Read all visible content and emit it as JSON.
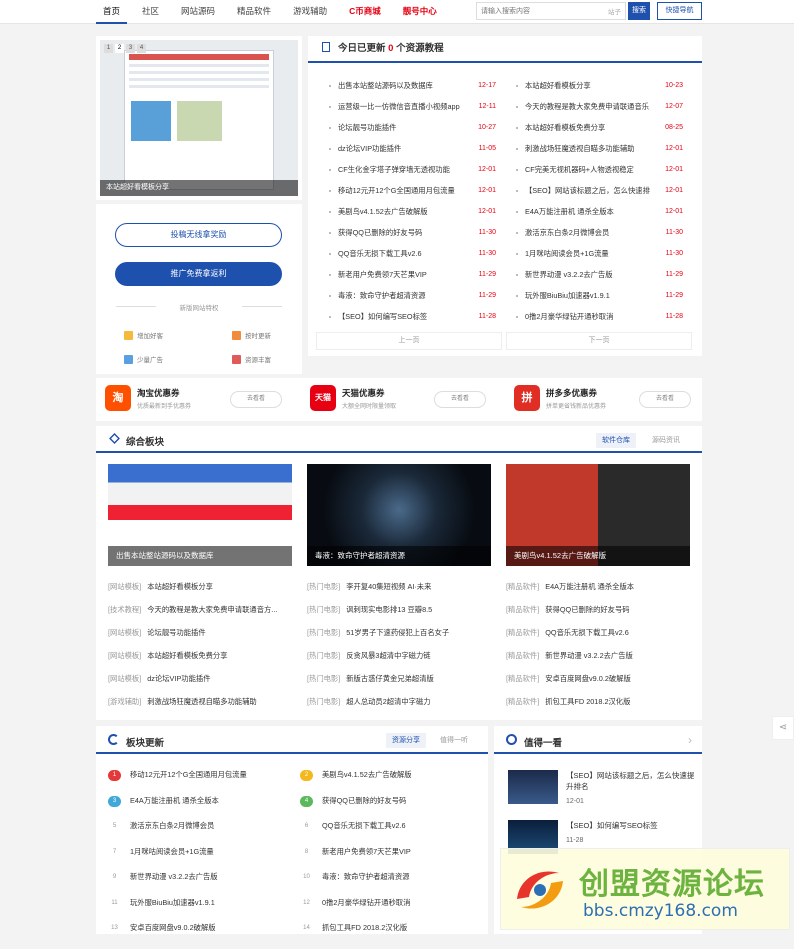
{
  "nav": {
    "items": [
      "首页",
      "社区",
      "网站源码",
      "精品软件",
      "游戏辅助",
      "C币商城",
      "靓号中心"
    ],
    "active": 0,
    "search_placeholder": "请输入搜索内容",
    "search_tag": "站子",
    "search_button": "搜索",
    "quick_button": "快捷导航"
  },
  "slider": {
    "pages": [
      "1",
      "2",
      "3",
      "4"
    ],
    "caption": "本站超好看模板分享"
  },
  "side": {
    "btn_submit": "投稿无线拿奖励",
    "btn_promote": "推广免费拿返利",
    "features_title": "新版网站特权",
    "features": [
      "增加好客",
      "按时更新",
      "少量广告",
      "资源丰富"
    ]
  },
  "updates": {
    "title_pre": "今日已更新",
    "count": "0",
    "title_post": "个资源教程",
    "left": [
      {
        "t": "出售本站整站源码以及数据库",
        "d": "12-17"
      },
      {
        "t": "运营级一比一仿微信音直播小视频app",
        "d": "12-11"
      },
      {
        "t": "论坛靓号功能插件",
        "d": "10-27"
      },
      {
        "t": "dz论坛VIP功能插件",
        "d": "11-05"
      },
      {
        "t": "CF生化金字塔子弹穿墙无透视功能",
        "d": "12-01"
      },
      {
        "t": "移动12元开12个G全国通用月包流量",
        "d": "12-01"
      },
      {
        "t": "美剧鸟v4.1.52去广告破解版",
        "d": "12-01"
      },
      {
        "t": "获得QQ已删除的好友号码",
        "d": "11-30"
      },
      {
        "t": "QQ音乐无损下载工具v2.6",
        "d": "11-30"
      },
      {
        "t": "新老用户免费领7天芒果VIP",
        "d": "11-29"
      },
      {
        "t": "毒液：致命守护者超清资源",
        "d": "11-29"
      },
      {
        "t": "【SEO】如何编写SEO标签",
        "d": "11-28"
      }
    ],
    "right": [
      {
        "t": "本站超好看模板分享",
        "d": "10-23"
      },
      {
        "t": "今天的教程是教大家免费申请联通音乐",
        "d": "12-07"
      },
      {
        "t": "本站超好看模板免费分享",
        "d": "08-25"
      },
      {
        "t": "刺激战场狂魔透视自瞄多功能辅助",
        "d": "12-01"
      },
      {
        "t": "CF完美无视机器码+人物透视稳定",
        "d": "12-01"
      },
      {
        "t": "【SEO】网站该标题之后，怎么快速排",
        "d": "12-01"
      },
      {
        "t": "E4A万能注册机 通杀全版本",
        "d": "12-01"
      },
      {
        "t": "激活京东白条2月微博会员",
        "d": "11-30"
      },
      {
        "t": "1月咪咕阅读会员+1G流量",
        "d": "11-30"
      },
      {
        "t": "新世界动漫 v3.2.2去广告版",
        "d": "11-29"
      },
      {
        "t": "玩外服BiuBiu加速器v1.9.1",
        "d": "11-29"
      },
      {
        "t": "0撸2月豪华绿钻开通秒取消",
        "d": "11-28"
      }
    ],
    "prev": "上一页",
    "next": "下一页"
  },
  "coupons": [
    {
      "logo": "淘",
      "name": "淘宝优惠券",
      "sub": "优质最新到手优惠券",
      "btn": "去看看",
      "color": "#ff5000"
    },
    {
      "logo": "天猫",
      "name": "天猫优惠券",
      "sub": "大额全网时限量领取",
      "btn": "去看看",
      "color": "#e60012"
    },
    {
      "logo": "拼",
      "name": "拼多多优惠券",
      "sub": "拼单更省钱新品优惠券",
      "btn": "去看看",
      "color": "#e02e24"
    }
  ],
  "zone": {
    "title": "综合板块",
    "tabs": [
      "软件仓库",
      "源码资讯"
    ],
    "captions": [
      "出售本站整站源码以及数据库",
      "毒液：致命守护者超清资源",
      "美剧鸟v4.1.52去广告破解版"
    ],
    "col1": [
      {
        "c": "[网站模板]",
        "t": "本站超好看模板分享"
      },
      {
        "c": "[技术教程]",
        "t": "今天的教程是教大家免费申请联通音方..."
      },
      {
        "c": "[网站模板]",
        "t": "论坛靓号功能插件"
      },
      {
        "c": "[网站模板]",
        "t": "本站超好看模板免费分享"
      },
      {
        "c": "[网站模板]",
        "t": "dz论坛VIP功能插件"
      },
      {
        "c": "[游戏辅助]",
        "t": "刺激战场狂魔透视自瞄多功能辅助"
      }
    ],
    "col2": [
      {
        "c": "[热门电影]",
        "t": "李开复40集短视频 AI·未来"
      },
      {
        "c": "[热门电影]",
        "t": "讽刺现实电影排13 豆瓣8.5"
      },
      {
        "c": "[热门电影]",
        "t": "51岁男子下速药侵犯上百名女子"
      },
      {
        "c": "[热门电影]",
        "t": "反贪风暴3超清中字磁力链"
      },
      {
        "c": "[热门电影]",
        "t": "新版古惑仔黄金兄弟超清版"
      },
      {
        "c": "[热门电影]",
        "t": "超人总动员2超清中字磁力"
      }
    ],
    "col3": [
      {
        "c": "[精品软件]",
        "t": "E4A万能注册机 通杀全版本"
      },
      {
        "c": "[精品软件]",
        "t": "获得QQ已删除的好友号码"
      },
      {
        "c": "[精品软件]",
        "t": "QQ音乐无损下载工具v2.6"
      },
      {
        "c": "[精品软件]",
        "t": "新世界动漫 v3.2.2去广告版"
      },
      {
        "c": "[精品软件]",
        "t": "安卓百度网盘v9.0.2破解版"
      },
      {
        "c": "[精品软件]",
        "t": "抓包工具FD 2018.2汉化版"
      }
    ]
  },
  "blocks": {
    "title": "板块更新",
    "tabs": [
      "资源分享",
      "值得一听"
    ],
    "left": [
      {
        "n": "1",
        "t": "移动12元开12个G全国通用月包流量"
      },
      {
        "n": "3",
        "t": "E4A万能注册机 通杀全版本"
      },
      {
        "n": "5",
        "t": "激活京东白条2月微博会员"
      },
      {
        "n": "7",
        "t": "1月咪咕阅读会员+1G流量"
      },
      {
        "n": "9",
        "t": "新世界动漫 v3.2.2去广告版"
      },
      {
        "n": "11",
        "t": "玩外服BiuBiu加速器v1.9.1"
      },
      {
        "n": "13",
        "t": "安卓百度网盘v9.0.2破解版"
      }
    ],
    "right": [
      {
        "n": "2",
        "t": "美剧鸟v4.1.52去广告破解版"
      },
      {
        "n": "4",
        "t": "获得QQ已删除的好友号码"
      },
      {
        "n": "6",
        "t": "QQ音乐无损下载工具v2.6"
      },
      {
        "n": "8",
        "t": "新老用户免费领7天芒果VIP"
      },
      {
        "n": "10",
        "t": "毒液：致命守护者超清资源"
      },
      {
        "n": "12",
        "t": "0撸2月豪华绿钻开通秒取消"
      },
      {
        "n": "14",
        "t": "抓包工具FD 2018.2汉化版"
      }
    ]
  },
  "worth": {
    "title": "值得一看",
    "items": [
      {
        "t": "【SEO】网站该标题之后，怎么快速提升排名",
        "d": "12-01"
      },
      {
        "t": "【SEO】如何编写SEO标签",
        "d": "11-28"
      }
    ]
  },
  "watermark": {
    "title": "创盟资源论坛",
    "url": "bbs.cmzy168.com"
  }
}
